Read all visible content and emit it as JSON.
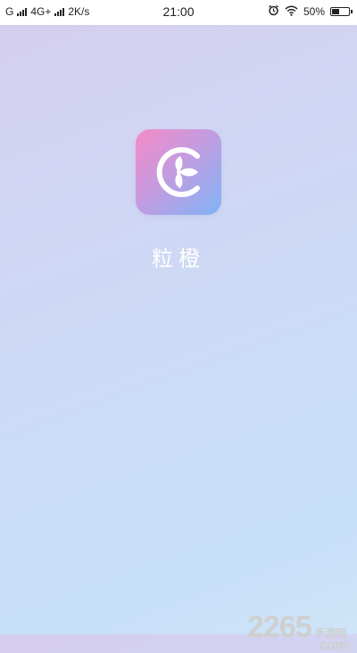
{
  "status_bar": {
    "carrier1": "G",
    "network": "4G+",
    "speed": "2K/s",
    "time": "21:00",
    "battery": "50%",
    "battery_level": 0.5,
    "icons": [
      "signal-icon",
      "alarm-icon",
      "wifi-icon",
      "battery-icon"
    ]
  },
  "app": {
    "name": "粒橙",
    "icon": "lichen-logo-icon",
    "icon_gradient": [
      "#f58ac6",
      "#c59be0",
      "#7fb4f6"
    ]
  },
  "watermark": {
    "number": "2265",
    "text": "手游网",
    "domain": ".com"
  },
  "colors": {
    "background_start": "#d6cdee",
    "background_end": "#c6e0f8",
    "app_name": "#ffffff"
  }
}
